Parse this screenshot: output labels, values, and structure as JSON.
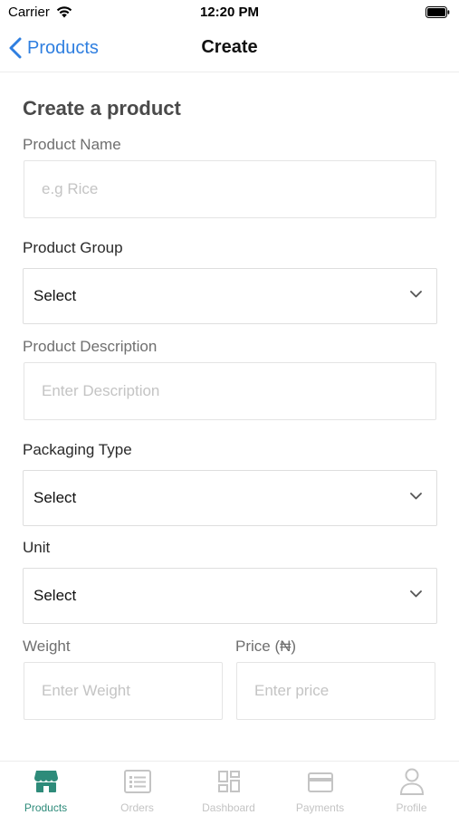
{
  "status_bar": {
    "carrier": "Carrier",
    "time": "12:20 PM"
  },
  "nav": {
    "back_label": "Products",
    "title": "Create"
  },
  "form": {
    "heading": "Create a product",
    "product_name": {
      "label": "Product Name",
      "placeholder": "e.g Rice",
      "value": ""
    },
    "product_group": {
      "label": "Product Group",
      "value": "Select"
    },
    "product_description": {
      "label": "Product Description",
      "placeholder": "Enter Description",
      "value": ""
    },
    "packaging_type": {
      "label": "Packaging Type",
      "value": "Select"
    },
    "unit": {
      "label": "Unit",
      "value": "Select"
    },
    "weight": {
      "label": "Weight",
      "placeholder": "Enter Weight",
      "value": ""
    },
    "price": {
      "label": "Price (₦)",
      "placeholder": "Enter price",
      "value": ""
    }
  },
  "tabs": [
    {
      "label": "Products",
      "icon": "store-icon",
      "active": true
    },
    {
      "label": "Orders",
      "icon": "list-icon",
      "active": false
    },
    {
      "label": "Dashboard",
      "icon": "grid-icon",
      "active": false
    },
    {
      "label": "Payments",
      "icon": "card-icon",
      "active": false
    },
    {
      "label": "Profile",
      "icon": "user-icon",
      "active": false
    }
  ],
  "colors": {
    "link_blue": "#2f7fe0",
    "active_tab": "#2e8b7a",
    "inactive_tab": "#c4c4c4"
  }
}
